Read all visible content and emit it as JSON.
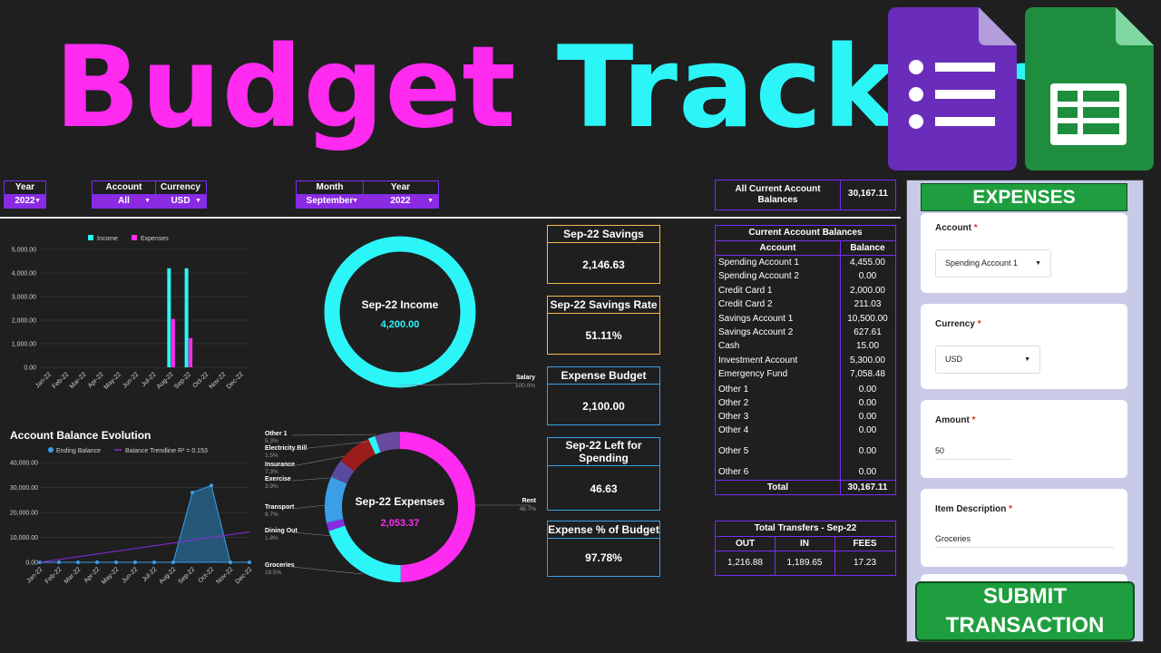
{
  "title": {
    "part1": "Budget",
    "part2": "Tracker"
  },
  "icons": {
    "forms": "google-forms-icon",
    "sheets": "google-sheets-icon"
  },
  "filters": {
    "year1": {
      "label": "Year",
      "value": "2022"
    },
    "account": {
      "label": "Account",
      "value": "All"
    },
    "currency": {
      "label": "Currency",
      "value": "USD"
    },
    "month": {
      "label": "Month",
      "value": "September"
    },
    "year2": {
      "label": "Year",
      "value": "2022"
    }
  },
  "all_balances": {
    "label": "All Current Account Balances",
    "value": "30,167.11"
  },
  "kpis": [
    {
      "label": "Sep-22 Savings",
      "value": "2,146.63"
    },
    {
      "label": "Sep-22 Savings Rate",
      "value": "51.11%"
    },
    {
      "label": "Expense Budget",
      "value": "2,100.00"
    },
    {
      "label": "Sep-22 Left for Spending",
      "value": "46.63"
    },
    {
      "label": "Expense % of Budget",
      "value": "97.78%"
    }
  ],
  "balances": {
    "title": "Current Account Balances",
    "headers": [
      "Account",
      "Balance"
    ],
    "rows": [
      {
        "account": "Spending Account 1",
        "balance": "4,455.00"
      },
      {
        "account": "Spending Account 2",
        "balance": "0.00"
      },
      {
        "account": "Credit Card 1",
        "balance": "2,000.00"
      },
      {
        "account": "Credit Card 2",
        "balance": "211.03"
      },
      {
        "account": "Savings Account 1",
        "balance": "10,500.00"
      },
      {
        "account": "Savings Account 2",
        "balance": "627.61"
      },
      {
        "account": "Cash",
        "balance": "15.00"
      },
      {
        "account": "Investment Account",
        "balance": "5,300.00"
      },
      {
        "account": "Emergency Fund",
        "balance": "7,058.48"
      },
      {
        "account": "Other 1",
        "balance": "0.00"
      },
      {
        "account": "Other 2",
        "balance": "0.00"
      },
      {
        "account": "Other 3",
        "balance": "0.00"
      },
      {
        "account": "Other 4",
        "balance": "0.00"
      },
      {
        "account": "Other 5",
        "balance": "0.00"
      },
      {
        "account": "Other 6",
        "balance": "0.00"
      }
    ],
    "total_label": "Total",
    "total_value": "30,167.11"
  },
  "transfers": {
    "title": "Total Transfers - Sep-22",
    "headers": [
      "OUT",
      "IN",
      "FEES"
    ],
    "values": [
      "1,216.88",
      "1,189.65",
      "17.23"
    ]
  },
  "form": {
    "header": "EXPENSES",
    "account_label": "Account",
    "account_value": "Spending Account 1",
    "currency_label": "Currency",
    "currency_value": "USD",
    "amount_label": "Amount",
    "amount_value": "50",
    "desc_label": "Item Description",
    "desc_value": "Groceries",
    "required_mark": "*",
    "submit_line1": "SUBMIT",
    "submit_line2": "TRANSACTION"
  },
  "colors": {
    "magenta": "#ff2bf0",
    "cyan": "#2cf5f8",
    "purple": "#7b2cf3",
    "gold": "#f6b94a",
    "blue": "#3a9fe6",
    "green": "#1e9e3e"
  },
  "chart_data": [
    {
      "type": "bar",
      "title": "",
      "categories": [
        "Jan-22",
        "Feb-22",
        "Mar-22",
        "Apr-22",
        "May-22",
        "Jun-22",
        "Jul-22",
        "Aug-22",
        "Sep-22",
        "Oct-22",
        "Nov-22",
        "Dec-22"
      ],
      "series": [
        {
          "name": "Income",
          "color": "#2cf5f8",
          "values": [
            0,
            0,
            0,
            0,
            0,
            0,
            0,
            4200,
            4200,
            0,
            0,
            0
          ]
        },
        {
          "name": "Expenses",
          "color": "#ff2bf0",
          "values": [
            0,
            0,
            0,
            0,
            0,
            0,
            0,
            2053.37,
            1240,
            0,
            0,
            0
          ]
        }
      ],
      "yticks": [
        "0.00",
        "1,000.00",
        "2,000.00",
        "3,000.00",
        "4,000.00",
        "5,000.00"
      ],
      "ylim": [
        0,
        5000
      ],
      "legend": "top"
    },
    {
      "type": "area",
      "title": "Account Balance Evolution",
      "categories": [
        "Jan-22",
        "Feb-22",
        "Mar-22",
        "Apr-22",
        "May-22",
        "Jun-22",
        "Jul-22",
        "Aug-22",
        "Sep-22",
        "Oct-22",
        "Nov-22",
        "Dec-22"
      ],
      "series": [
        {
          "name": "Ending Balance",
          "color": "#3a9fe6",
          "values": [
            0,
            0,
            0,
            0,
            0,
            0,
            0,
            0,
            28000,
            30800,
            0,
            0
          ]
        },
        {
          "name": "Balance Trendline R² = 0.153",
          "color": "#8a2be2",
          "values": [
            -2100,
            -800,
            500,
            1800,
            3100,
            4400,
            5700,
            7000,
            8300,
            9600,
            10900,
            12200
          ]
        }
      ],
      "yticks": [
        "0.00",
        "10,000.00",
        "20,000.00",
        "30,000.00",
        "40,000.00"
      ],
      "ylim": [
        0,
        40000
      ],
      "legend": "top"
    },
    {
      "type": "pie",
      "title": "Sep-22 Income",
      "center_value": "4,200.00",
      "slices": [
        {
          "label": "Salary",
          "pct": "100.0%",
          "value": 100
        }
      ]
    },
    {
      "type": "pie",
      "title": "Sep-22 Expenses",
      "center_value": "2,053.37",
      "slices": [
        {
          "label": "Rent",
          "pct": "48.7%",
          "value": 48.7,
          "color": "#ff2bf0"
        },
        {
          "label": "Groceries",
          "pct": "19.5%",
          "value": 19.5,
          "color": "#2cf5f8"
        },
        {
          "label": "Dining Out",
          "pct": "1.8%",
          "value": 1.8,
          "color": "#8a2be2"
        },
        {
          "label": "Transport",
          "pct": "9.7%",
          "value": 9.7,
          "color": "#3a9fe6"
        },
        {
          "label": "Exercise",
          "pct": "3.9%",
          "value": 3.9,
          "color": "#5a4a9e"
        },
        {
          "label": "Insurance",
          "pct": "7.3%",
          "value": 7.3,
          "color": "#9c1b1b"
        },
        {
          "label": "Electricity Bill",
          "pct": "1.5%",
          "value": 1.5,
          "color": "#2cf5f8"
        },
        {
          "label": "Other 1",
          "pct": "5.3%",
          "value": 5.3,
          "color": "#6a4a9e"
        }
      ]
    }
  ]
}
